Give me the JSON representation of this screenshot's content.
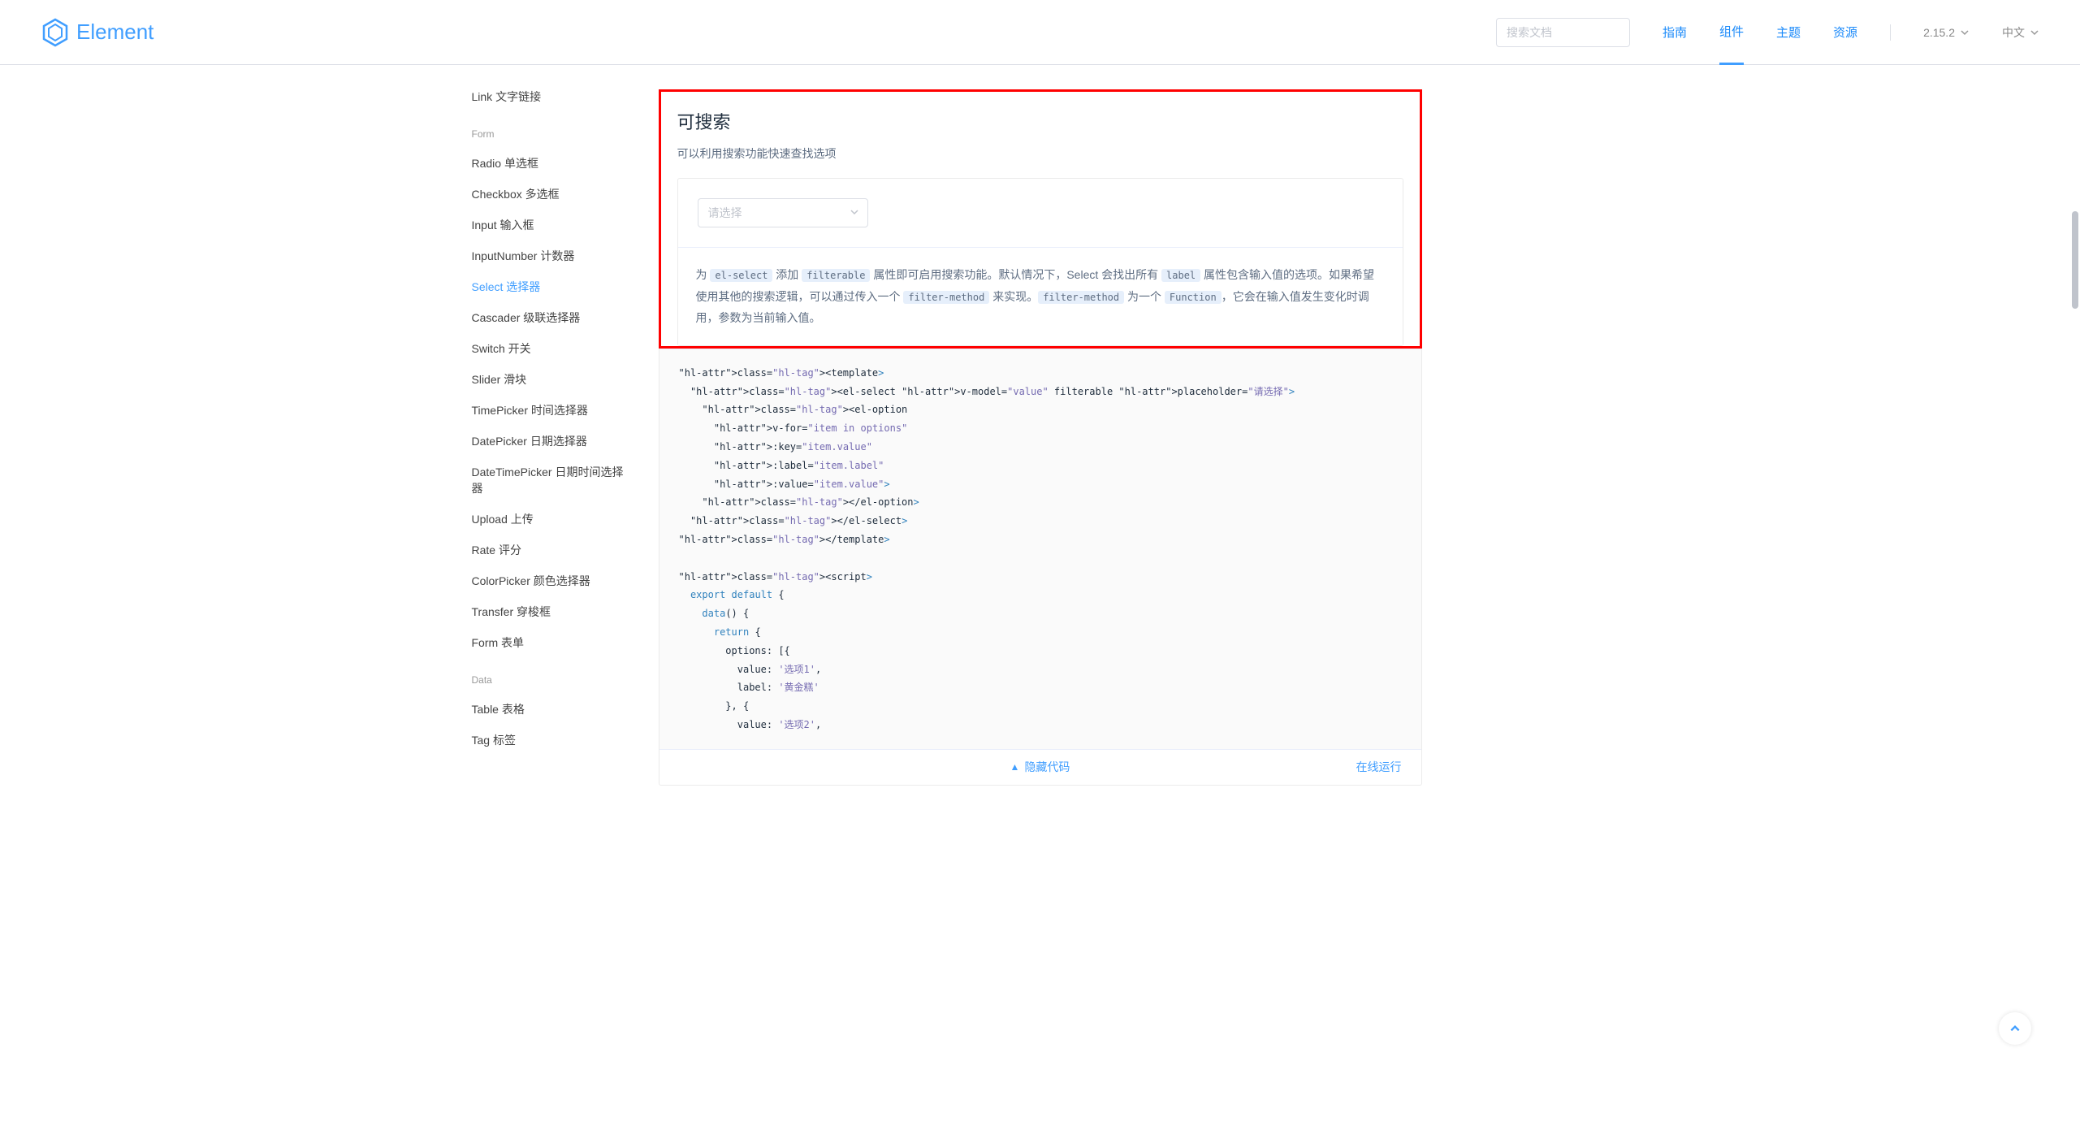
{
  "header": {
    "brand": "Element",
    "search_placeholder": "搜索文档",
    "nav": [
      "指南",
      "组件",
      "主题",
      "资源"
    ],
    "nav_active_index": 1,
    "version": "2.15.2",
    "language": "中文"
  },
  "sidebar": {
    "items_top": [
      "Link 文字链接"
    ],
    "group_form": "Form",
    "items_form": [
      "Radio 单选框",
      "Checkbox 多选框",
      "Input 输入框",
      "InputNumber 计数器",
      "Select 选择器",
      "Cascader 级联选择器",
      "Switch 开关",
      "Slider 滑块",
      "TimePicker 时间选择器",
      "DatePicker 日期选择器",
      "DateTimePicker 日期时间选择器",
      "Upload 上传",
      "Rate 评分",
      "ColorPicker 颜色选择器",
      "Transfer 穿梭框",
      "Form 表单"
    ],
    "form_active_index": 4,
    "group_data": "Data",
    "items_data": [
      "Table 表格",
      "Tag 标签"
    ]
  },
  "section": {
    "title": "可搜索",
    "subtitle": "可以利用搜索功能快速查找选项",
    "select_placeholder": "请选择",
    "desc_parts": {
      "p1": "为 ",
      "c1": "el-select",
      "p2": " 添加 ",
      "c2": "filterable",
      "p3": " 属性即可启用搜索功能。默认情况下，Select 会找出所有 ",
      "c3": "label",
      "p4": " 属性包含输入值的选项。如果希望使用其他的搜索逻辑，可以通过传入一个 ",
      "c4": "filter-method",
      "p5": " 来实现。",
      "c5": "filter-method",
      "p6": " 为一个 ",
      "c6": "Function",
      "p7": "，它会在输入值发生变化时调用，参数为当前输入值。"
    },
    "code_lines": [
      {
        "t": "tag",
        "s": "<template>"
      },
      {
        "t": "line",
        "s": "  <el-select v-model=\"value\" filterable placeholder=\"请选择\">"
      },
      {
        "t": "line",
        "s": "    <el-option"
      },
      {
        "t": "line",
        "s": "      v-for=\"item in options\""
      },
      {
        "t": "line",
        "s": "      :key=\"item.value\""
      },
      {
        "t": "line",
        "s": "      :label=\"item.label\""
      },
      {
        "t": "line",
        "s": "      :value=\"item.value\">"
      },
      {
        "t": "line",
        "s": "    </el-option>"
      },
      {
        "t": "line",
        "s": "  </el-select>"
      },
      {
        "t": "tag",
        "s": "</template>"
      },
      {
        "t": "blank",
        "s": ""
      },
      {
        "t": "tag",
        "s": "<script​>"
      },
      {
        "t": "line",
        "s": "  export default {"
      },
      {
        "t": "line",
        "s": "    data() {"
      },
      {
        "t": "line",
        "s": "      return {"
      },
      {
        "t": "line",
        "s": "        options: [{"
      },
      {
        "t": "line",
        "s": "          value: '选项1',"
      },
      {
        "t": "line",
        "s": "          label: '黄金糕'"
      },
      {
        "t": "line",
        "s": "        }, {"
      },
      {
        "t": "line",
        "s": "          value: '选项2',"
      }
    ],
    "hide_code": "隐藏代码",
    "run_online": "在线运行"
  }
}
